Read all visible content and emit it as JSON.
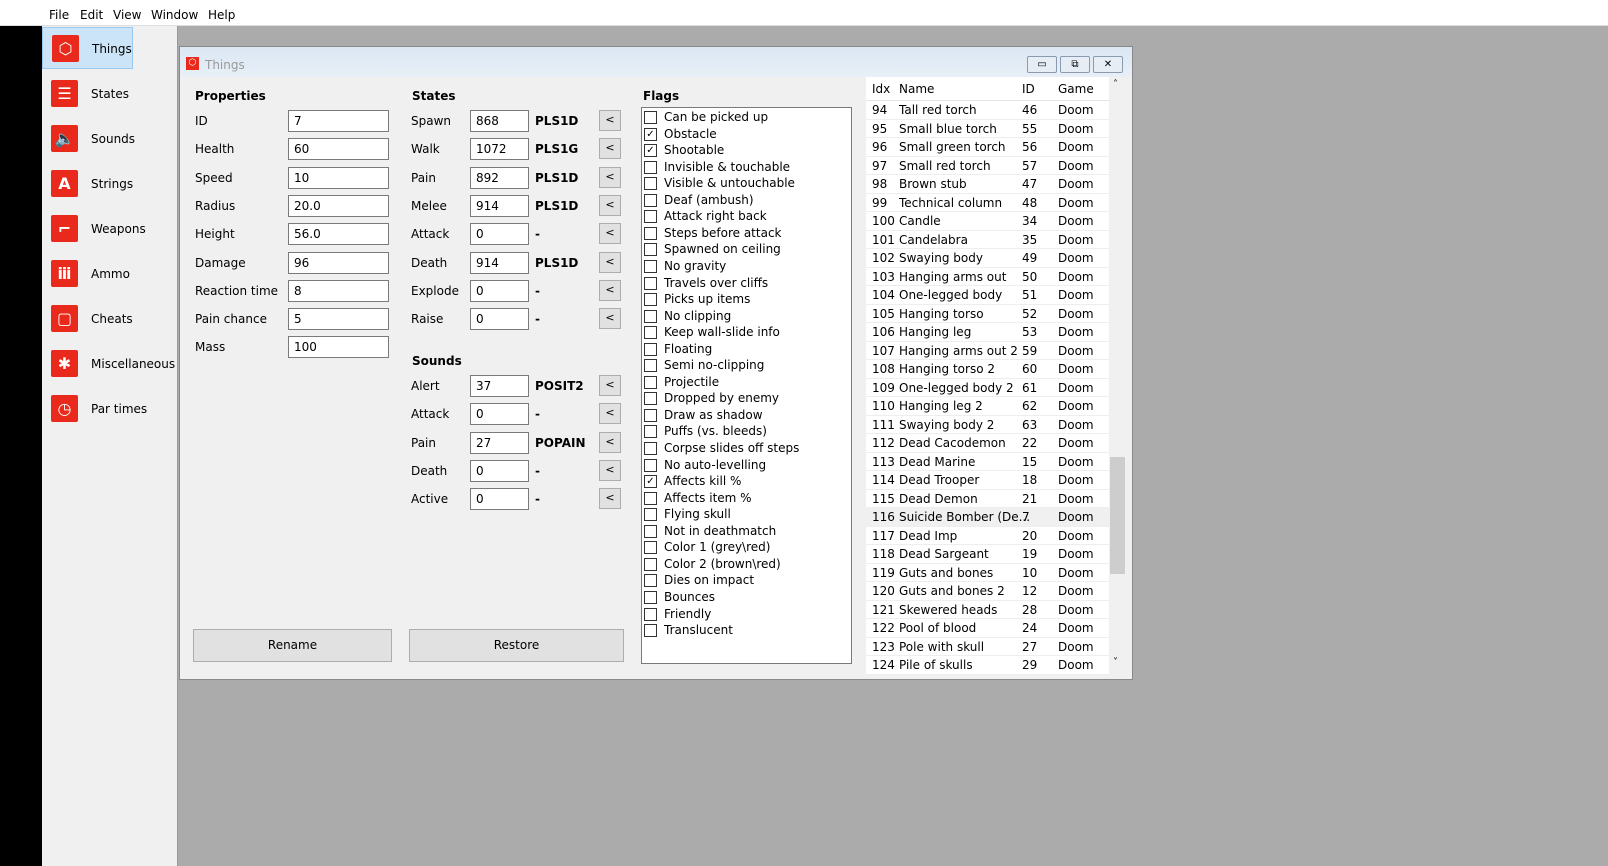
{
  "menu": [
    "File",
    "Edit",
    "View",
    "Window",
    "Help"
  ],
  "sidebar": [
    {
      "label": "Things",
      "icon": "cube-icon",
      "glyph": "⬡"
    },
    {
      "label": "States",
      "icon": "list-icon",
      "glyph": "☰"
    },
    {
      "label": "Sounds",
      "icon": "speaker-icon",
      "glyph": "🔈"
    },
    {
      "label": "Strings",
      "icon": "letter-a-icon",
      "glyph": "A"
    },
    {
      "label": "Weapons",
      "icon": "pistol-icon",
      "glyph": "⌐"
    },
    {
      "label": "Ammo",
      "icon": "bullets-icon",
      "glyph": "ⅲ"
    },
    {
      "label": "Cheats",
      "icon": "square-icon",
      "glyph": "▢"
    },
    {
      "label": "Miscellaneous",
      "icon": "asterisk-icon",
      "glyph": "✱"
    },
    {
      "label": "Par times",
      "icon": "clock-icon",
      "glyph": "◷"
    }
  ],
  "window": {
    "title": "Things"
  },
  "properties": {
    "heading": "Properties",
    "fields": [
      {
        "label": "ID",
        "value": "7"
      },
      {
        "label": "Health",
        "value": "60"
      },
      {
        "label": "Speed",
        "value": "10"
      },
      {
        "label": "Radius",
        "value": "20.0"
      },
      {
        "label": "Height",
        "value": "56.0"
      },
      {
        "label": "Damage",
        "value": "96"
      },
      {
        "label": "Reaction time",
        "value": "8"
      },
      {
        "label": "Pain chance",
        "value": "5"
      },
      {
        "label": "Mass",
        "value": "100"
      }
    ]
  },
  "states": {
    "heading": "States",
    "rows": [
      {
        "label": "Spawn",
        "value": "868",
        "name": "PLS1D"
      },
      {
        "label": "Walk",
        "value": "1072",
        "name": "PLS1G"
      },
      {
        "label": "Pain",
        "value": "892",
        "name": "PLS1D"
      },
      {
        "label": "Melee",
        "value": "914",
        "name": "PLS1D"
      },
      {
        "label": "Attack",
        "value": "0",
        "name": "-"
      },
      {
        "label": "Death",
        "value": "914",
        "name": "PLS1D"
      },
      {
        "label": "Explode",
        "value": "0",
        "name": "-"
      },
      {
        "label": "Raise",
        "value": "0",
        "name": "-"
      }
    ]
  },
  "sounds": {
    "heading": "Sounds",
    "rows": [
      {
        "label": "Alert",
        "value": "37",
        "name": "POSIT2"
      },
      {
        "label": "Attack",
        "value": "0",
        "name": "-"
      },
      {
        "label": "Pain",
        "value": "27",
        "name": "POPAIN"
      },
      {
        "label": "Death",
        "value": "0",
        "name": "-"
      },
      {
        "label": "Active",
        "value": "0",
        "name": "-"
      }
    ]
  },
  "set_button": "<",
  "buttons": {
    "rename": "Rename",
    "restore": "Restore"
  },
  "flags": {
    "heading": "Flags",
    "items": [
      {
        "label": "Can be picked up",
        "checked": false
      },
      {
        "label": "Obstacle",
        "checked": true
      },
      {
        "label": "Shootable",
        "checked": true
      },
      {
        "label": "Invisible & touchable",
        "checked": false
      },
      {
        "label": "Visible & untouchable",
        "checked": false
      },
      {
        "label": "Deaf (ambush)",
        "checked": false
      },
      {
        "label": "Attack right back",
        "checked": false
      },
      {
        "label": "Steps before attack",
        "checked": false
      },
      {
        "label": "Spawned on ceiling",
        "checked": false
      },
      {
        "label": "No gravity",
        "checked": false
      },
      {
        "label": "Travels over cliffs",
        "checked": false
      },
      {
        "label": "Picks up items",
        "checked": false
      },
      {
        "label": "No clipping",
        "checked": false
      },
      {
        "label": "Keep wall-slide info",
        "checked": false
      },
      {
        "label": "Floating",
        "checked": false
      },
      {
        "label": "Semi no-clipping",
        "checked": false
      },
      {
        "label": "Projectile",
        "checked": false
      },
      {
        "label": "Dropped by enemy",
        "checked": false
      },
      {
        "label": "Draw as shadow",
        "checked": false
      },
      {
        "label": "Puffs (vs. bleeds)",
        "checked": false
      },
      {
        "label": "Corpse slides off steps",
        "checked": false
      },
      {
        "label": "No auto-levelling",
        "checked": false
      },
      {
        "label": "Affects kill %",
        "checked": true
      },
      {
        "label": "Affects item %",
        "checked": false
      },
      {
        "label": "Flying skull",
        "checked": false
      },
      {
        "label": "Not in deathmatch",
        "checked": false
      },
      {
        "label": "Color 1 (grey\\red)",
        "checked": false
      },
      {
        "label": "Color 2 (brown\\red)",
        "checked": false
      },
      {
        "label": "Dies on impact",
        "checked": false
      },
      {
        "label": "Bounces",
        "checked": false
      },
      {
        "label": "Friendly",
        "checked": false
      },
      {
        "label": "Translucent",
        "checked": false
      }
    ]
  },
  "table": {
    "columns": [
      "Idx",
      "Name",
      "ID",
      "Game"
    ],
    "selected_idx": "116",
    "rows": [
      [
        "94",
        "Tall red torch",
        "46",
        "Doom"
      ],
      [
        "95",
        "Small blue torch",
        "55",
        "Doom"
      ],
      [
        "96",
        "Small green torch",
        "56",
        "Doom"
      ],
      [
        "97",
        "Small red torch",
        "57",
        "Doom"
      ],
      [
        "98",
        "Brown stub",
        "47",
        "Doom"
      ],
      [
        "99",
        "Technical column",
        "48",
        "Doom"
      ],
      [
        "100",
        "Candle",
        "34",
        "Doom"
      ],
      [
        "101",
        "Candelabra",
        "35",
        "Doom"
      ],
      [
        "102",
        "Swaying body",
        "49",
        "Doom"
      ],
      [
        "103",
        "Hanging arms out",
        "50",
        "Doom"
      ],
      [
        "104",
        "One-legged body",
        "51",
        "Doom"
      ],
      [
        "105",
        "Hanging torso",
        "52",
        "Doom"
      ],
      [
        "106",
        "Hanging leg",
        "53",
        "Doom"
      ],
      [
        "107",
        "Hanging arms out 2",
        "59",
        "Doom"
      ],
      [
        "108",
        "Hanging torso 2",
        "60",
        "Doom"
      ],
      [
        "109",
        "One-legged body 2",
        "61",
        "Doom"
      ],
      [
        "110",
        "Hanging leg 2",
        "62",
        "Doom"
      ],
      [
        "111",
        "Swaying body 2",
        "63",
        "Doom"
      ],
      [
        "112",
        "Dead Cacodemon",
        "22",
        "Doom"
      ],
      [
        "113",
        "Dead Marine",
        "15",
        "Doom"
      ],
      [
        "114",
        "Dead Trooper",
        "18",
        "Doom"
      ],
      [
        "115",
        "Dead Demon",
        "21",
        "Doom"
      ],
      [
        "116",
        "Suicide Bomber (De...",
        "7",
        "Doom"
      ],
      [
        "117",
        "Dead Imp",
        "20",
        "Doom"
      ],
      [
        "118",
        "Dead Sargeant",
        "19",
        "Doom"
      ],
      [
        "119",
        "Guts and bones",
        "10",
        "Doom"
      ],
      [
        "120",
        "Guts and bones 2",
        "12",
        "Doom"
      ],
      [
        "121",
        "Skewered heads",
        "28",
        "Doom"
      ],
      [
        "122",
        "Pool of blood",
        "24",
        "Doom"
      ],
      [
        "123",
        "Pole with skull",
        "27",
        "Doom"
      ],
      [
        "124",
        "Pile of skulls",
        "29",
        "Doom"
      ]
    ]
  },
  "colors": {
    "accent": "#e8291c",
    "selection": "#cce4f7",
    "mdi_background": "#ababab"
  }
}
